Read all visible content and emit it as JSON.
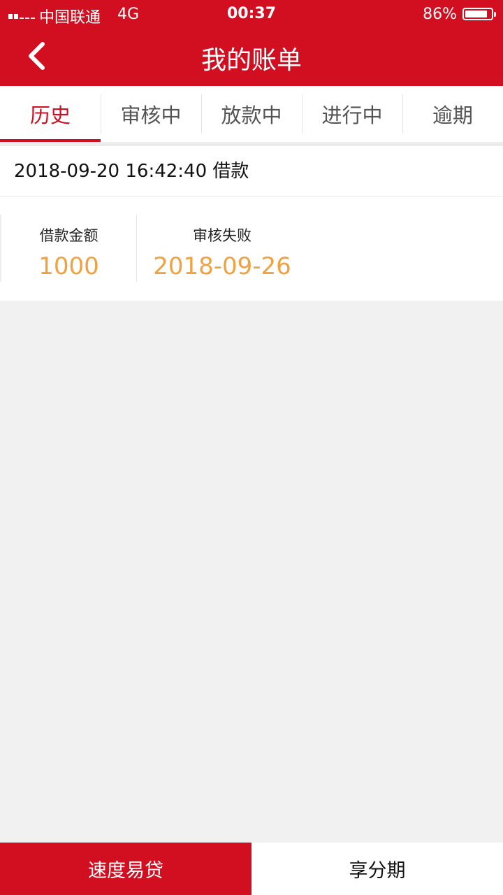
{
  "status_bar": {
    "carrier": "中国联通",
    "network": "4G",
    "time": "00:37",
    "battery_percent": "86%",
    "battery_level": 0.86
  },
  "header": {
    "title": "我的账单",
    "back_icon": "chevron-left-icon"
  },
  "tabs": [
    {
      "label": "历史",
      "active": true
    },
    {
      "label": "审核中",
      "active": false
    },
    {
      "label": "放款中",
      "active": false
    },
    {
      "label": "进行中",
      "active": false
    },
    {
      "label": "逾期",
      "active": false
    }
  ],
  "record": {
    "title": "2018-09-20 16:42:40 借款",
    "amount_label": "借款金额",
    "amount_value": "1000",
    "status_label": "审核失败",
    "status_date": "2018-09-26"
  },
  "footer": {
    "primary_label": "速度易贷",
    "secondary_label": "享分期"
  },
  "colors": {
    "brand_red": "#d10f20",
    "value_orange": "#f0a140",
    "background": "#f1f1f1"
  }
}
